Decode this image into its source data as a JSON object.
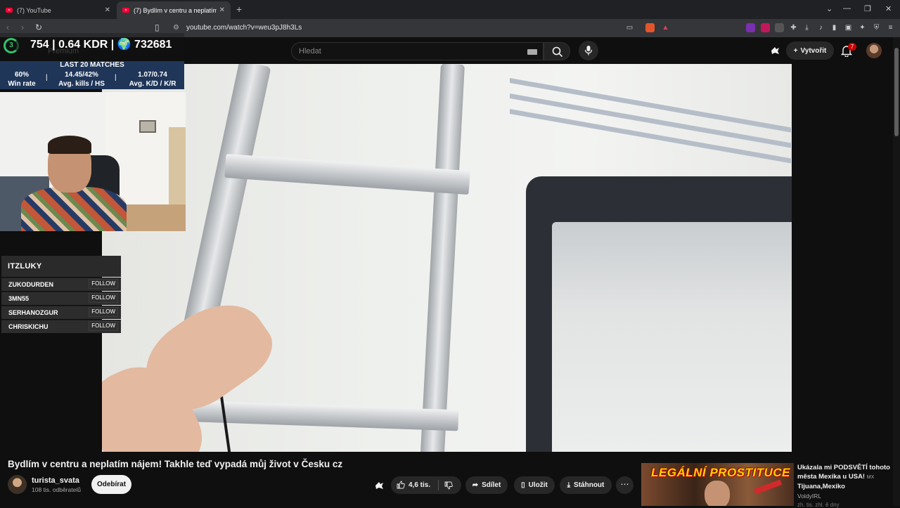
{
  "browser": {
    "tabs": [
      {
        "title": "(7) YouTube"
      },
      {
        "title": "(7) Bydlím v centru a neplatím náj"
      }
    ],
    "new_tab": "+",
    "close_glyph": "✕",
    "url": "youtube.com/watch?v=weu3pJ8h3Ls",
    "window_controls": [
      "⌄",
      "—",
      "❐",
      "✕"
    ]
  },
  "youtube_header": {
    "search_placeholder": "Hledat",
    "create_label": "Vytvořit",
    "notifications_count": "7",
    "premium_ghost": "Premium"
  },
  "overlay": {
    "level": "3",
    "stats_line": "754 | 0.64 KDR | 🌍 732681",
    "header": "LAST 20 MATCHES",
    "stats": [
      {
        "value": "60%",
        "label": "Win rate"
      },
      {
        "value": "14.45/42%",
        "label": "Avg. kills / HS"
      },
      {
        "value": "1.07/0.74",
        "label": "Avg. K/D / K/R"
      }
    ],
    "separator": "|",
    "follow_panel": {
      "title": "ITZLUKY",
      "follow_label": "FOLLOW",
      "rows": [
        "ZUKODURDEN",
        "3MN55",
        "SERHANOZGUR",
        "CHRISKICHU"
      ]
    }
  },
  "video": {
    "title": "Bydlím v centru a neplatím nájem! Takhle teď vypadá můj život v Česku cz",
    "channel": "turista_svata",
    "subscribers": "108 tis. odběratelů",
    "subscribe_label": "Odebírat",
    "likes": "4,6 tis.",
    "share_label": "Sdílet",
    "save_label": "Uložit",
    "download_label": "Stáhnout",
    "more_label": "⋯"
  },
  "recommendation": {
    "thumb_text": "LEGÁLNÍ PROSTITUCE",
    "title": "Ukázala mi PODSVĚTÍ tohoto města Mexika u USA!",
    "flag": "MX",
    "title_suffix": "Tijuana,Mexiko",
    "channel": "VoldyIRL",
    "meta": "zh. tis. zhl. ě dny"
  },
  "colors": {
    "accent_red": "#ff0033",
    "level_green": "#34c26b",
    "stats_blue": "#1f3659"
  }
}
